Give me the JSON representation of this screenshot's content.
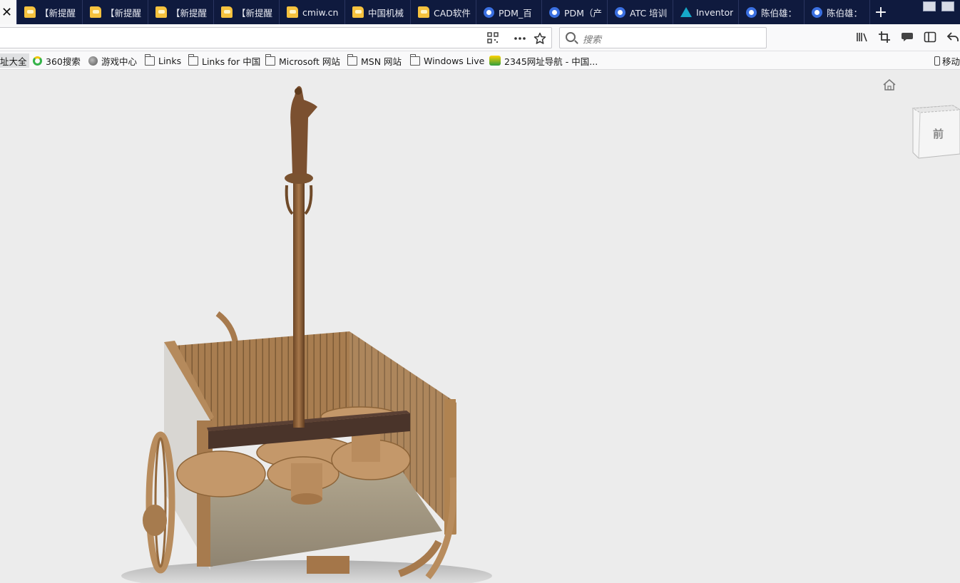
{
  "tabs": [
    {
      "label": "",
      "icon": "close-icon",
      "active": true
    },
    {
      "label": "【新提醒",
      "icon": "folder-icon"
    },
    {
      "label": "【新提醒",
      "icon": "folder-icon"
    },
    {
      "label": "【新提醒",
      "icon": "folder-icon"
    },
    {
      "label": "【新提醒",
      "icon": "folder-icon"
    },
    {
      "label": "cmiw.cn",
      "icon": "folder-icon"
    },
    {
      "label": "中国机械",
      "icon": "folder-icon"
    },
    {
      "label": "CAD软件",
      "icon": "folder-icon"
    },
    {
      "label": "PDM_百",
      "icon": "baidu-paw-icon"
    },
    {
      "label": "PDM（产",
      "icon": "baidu-paw-icon"
    },
    {
      "label": "ATC 培训",
      "icon": "baidu-paw-icon"
    },
    {
      "label": "Inventor",
      "icon": "autodesk-icon"
    },
    {
      "label": "陈伯雄：",
      "icon": "baidu-paw-icon"
    },
    {
      "label": "陈伯雄：",
      "icon": "baidu-paw-icon"
    }
  ],
  "close_glyph": "✕",
  "new_tab_glyph": "+",
  "search": {
    "placeholder": "搜索"
  },
  "bookmarks": [
    {
      "label": "址大全",
      "icon": "none"
    },
    {
      "label": "360搜索",
      "icon": "360-icon"
    },
    {
      "label": "游戏中心",
      "icon": "globe-icon"
    },
    {
      "label": "Links",
      "icon": "folder-icon"
    },
    {
      "label": "Links for 中国",
      "icon": "folder-icon"
    },
    {
      "label": "Microsoft 网站",
      "icon": "folder-icon"
    },
    {
      "label": "MSN 网站",
      "icon": "folder-icon"
    },
    {
      "label": "Windows Live",
      "icon": "folder-icon"
    },
    {
      "label": "2345网址导航 - 中国...",
      "icon": "2345-icon"
    }
  ],
  "mobile_bookmarks": "移动",
  "viewcube": {
    "face_label": "前"
  },
  "colors": {
    "tabbar_bg": "#0f1a3e",
    "viewer_bg": "#ececec",
    "wood": "#a07448",
    "dark_beam": "#4a342a"
  }
}
